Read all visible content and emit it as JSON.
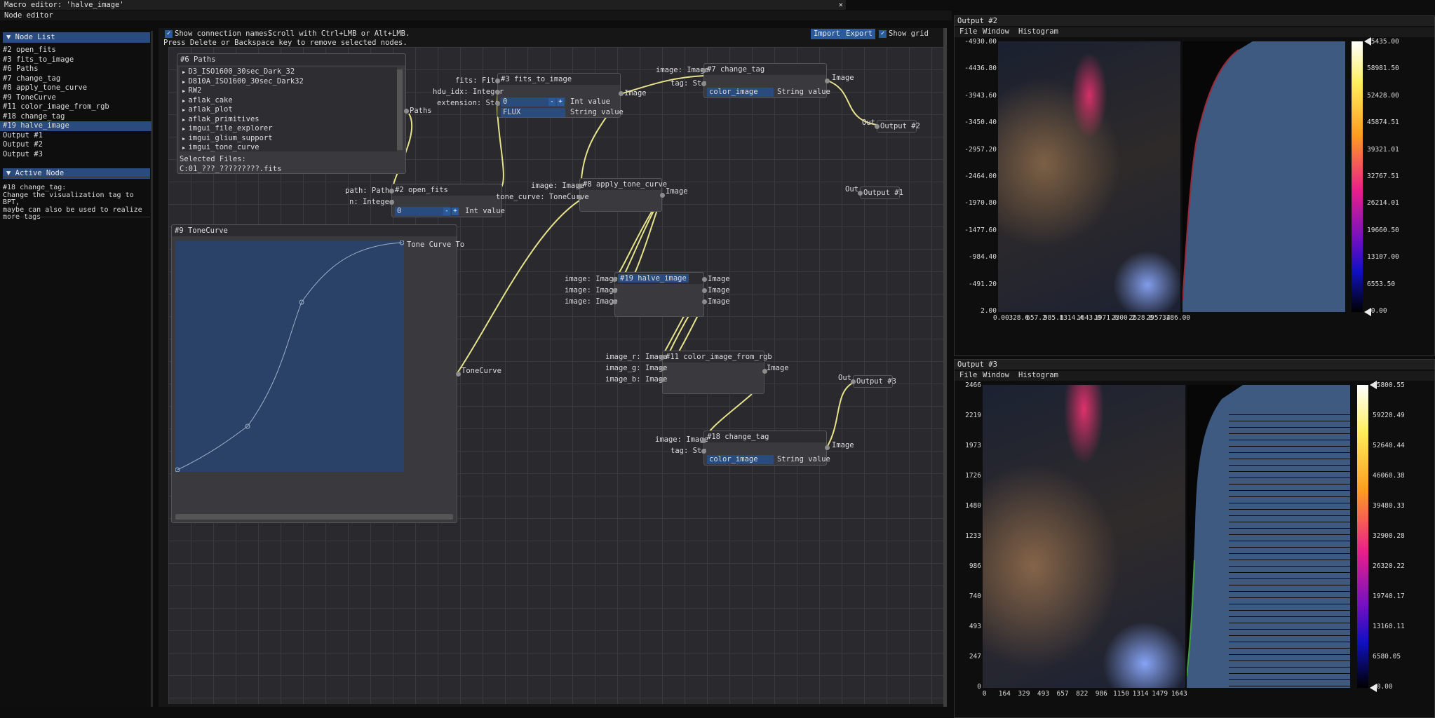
{
  "window_title": "Macro editor: 'halve_image'",
  "editor_title": "Node editor",
  "node_list": {
    "header": "Node List",
    "items": [
      "#2 open_fits",
      "#3 fits_to_image",
      "#6 Paths",
      "#7 change_tag",
      "#8 apply_tone_curve",
      "#9 ToneCurve",
      "#11 color_image_from_rgb",
      "#18 change_tag",
      "#19 halve_image",
      "Output #1",
      "Output #2",
      "Output #3"
    ],
    "selected_index": 8
  },
  "active_node": {
    "header": "Active Node",
    "name": "#18 change_tag:",
    "description": [
      "Change the visualization tag to BPT,",
      "maybe can also be used to realize",
      "more tags"
    ]
  },
  "toolbar": {
    "show_conn_label": "Show connection names.",
    "scroll_hint": "Scroll with Ctrl+LMB or Alt+LMB.",
    "delete_hint": "Press Delete or Backspace key to remove selected nodes.",
    "import_label": "Import",
    "export_label": "Export",
    "show_grid_label": "Show grid"
  },
  "nodes": {
    "paths": {
      "title": "#6 Paths",
      "items": [
        "D3_ISO1600_30sec_Dark_32",
        "D810A_ISO1600_30sec_Dark32",
        "RW2",
        "aflak_cake",
        "aflak_plot",
        "aflak_primitives",
        "imgui_file_explorer",
        "imgui_glium_support",
        "imgui_tone_curve"
      ],
      "selected_files_label": "Selected Files:",
      "selected_files_value": "C:01_???_?????????.fits",
      "out_label": "Paths"
    },
    "open_fits": {
      "title": "#2 open_fits",
      "in_path": "path: Paths",
      "in_n": "n: Integer",
      "int_value": "0",
      "int_label": "Int value",
      "minus": "-",
      "plus": "+"
    },
    "fits_to_image": {
      "title": "#3 fits_to_image",
      "in_fits": "fits: Fits",
      "in_hdu": "hdu_idx: Integer",
      "in_ext": "extension: Str",
      "int_value": "0",
      "int_label": "Int value",
      "str_value": "FLUX",
      "str_label": "String value",
      "out": "Image",
      "minus": "-",
      "plus": "+"
    },
    "change_tag7": {
      "title": "#7 change_tag",
      "in_image": "image: Image",
      "in_tag": "tag: Str",
      "str_value": "color_image",
      "str_label": "String value",
      "out": "Image"
    },
    "apply_tone_curve": {
      "title": "#8 apply_tone_curve",
      "in_image": "image: Image",
      "in_curve": "tone_curve: ToneCurve",
      "out": "Image"
    },
    "tone_curve": {
      "title": "#9 ToneCurve",
      "out": "ToneCurve",
      "label": "Tone Curve To"
    },
    "halve_image": {
      "title": "#19 halve_image",
      "in": [
        "image: Image",
        "image: Image",
        "image: Image"
      ],
      "out": [
        "Image",
        "Image",
        "Image"
      ]
    },
    "color_rgb": {
      "title": "#11 color_image_from_rgb",
      "in": [
        "image_r: Image",
        "image_g: Image",
        "image_b: Image"
      ],
      "out": "Image"
    },
    "change_tag18": {
      "title": "#18 change_tag",
      "in_image": "image: Image",
      "in_tag": "tag: Str",
      "str_value": "color_image",
      "str_label": "String value",
      "out": "Image"
    },
    "output1": {
      "title": "Output #1",
      "in": "Out"
    },
    "output2": {
      "title": "Output #2",
      "in": "Out"
    },
    "output3": {
      "title": "Output #3",
      "in": "Out"
    }
  },
  "output2_window": {
    "title": "Output #2",
    "menu": [
      "File",
      "Window",
      "Histogram"
    ],
    "y_ticks": [
      "-4930.00",
      "-4436.80",
      "-3943.60",
      "-3450.40",
      "-2957.20",
      "-2464.00",
      "-1970.80",
      "-1477.60",
      "-984.40",
      "-491.20",
      "2.00"
    ],
    "x_ticks": [
      "0.00",
      "328.6",
      "657.2",
      "985.8",
      "1314.4",
      "1643.0",
      "1971.6",
      "2300.2",
      "2628.8",
      "2957.4",
      "3286.00"
    ],
    "colorbar_ticks": [
      "65435.00",
      "58981.50",
      "52428.00",
      "45874.51",
      "39321.01",
      "32767.51",
      "26214.01",
      "19660.50",
      "13107.00",
      "6553.50",
      "-0.00"
    ]
  },
  "output3_window": {
    "title": "Output #3",
    "menu": [
      "File",
      "Window",
      "Histogram"
    ],
    "y_ticks": [
      "2466",
      "2219",
      "1973",
      "1726",
      "1480",
      "1233",
      "986",
      "740",
      "493",
      "247",
      "0"
    ],
    "x_ticks": [
      "0",
      "164",
      "329",
      "493",
      "657",
      "822",
      "986",
      "1150",
      "1314",
      "1479",
      "1643"
    ],
    "colorbar_ticks": [
      "65800.55",
      "59220.49",
      "52640.44",
      "46060.38",
      "39480.33",
      "32900.28",
      "26320.22",
      "19740.17",
      "13160.11",
      "6580.05",
      "-0.00"
    ]
  }
}
